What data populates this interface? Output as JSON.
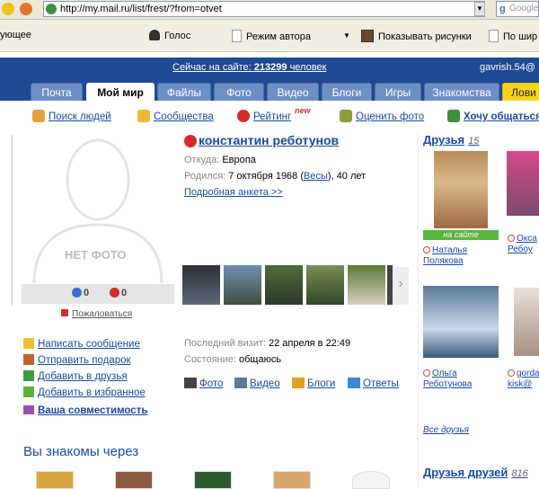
{
  "browser": {
    "url": "http://my.mail.ru/list/frest/?from=otvet",
    "search_hint": "Google",
    "toolbar": {
      "left_partial": "ующее",
      "voice": "Голос",
      "author_mode": "Режим автора",
      "show_images": "Показывать рисунки",
      "more": "По шир"
    }
  },
  "header": {
    "online_prefix": "Сейчас на сайте:",
    "online_count": "213299",
    "online_suffix": "человек",
    "user": "gavrish.54@",
    "tabs": [
      "Почта",
      "Мой мир",
      "Файлы",
      "Фото",
      "Видео",
      "Блоги",
      "Игры",
      "Знакомства",
      "Лови"
    ]
  },
  "quicklinks": {
    "people": "Поиск людей",
    "communities": "Сообщества",
    "rating": "Рейтинг",
    "rating_badge": "new",
    "rate_photo": "Оценить фото",
    "want_chat": "Хочу общаться"
  },
  "left": {
    "no_photo": "НЕТ ФОТО",
    "votes_plus": "0",
    "votes_minus": "0",
    "complain": "Пожаловаться",
    "actions": [
      "Написать сообщение",
      "Отправить подарок",
      "Добавить в друзья",
      "Добавить в избранное"
    ],
    "compat": "Ваша совместимость",
    "through_title": "Вы знакомы через"
  },
  "profile": {
    "name": "константин реботунов",
    "from_label": "Откуда:",
    "from_value": "Европа",
    "born_label": "Родился:",
    "born_date": "7 октября 1968",
    "born_sign": "Весы",
    "born_age": ", 40 лет",
    "more_link": "Подробная анкета >>",
    "last_visit_label": "Последний визит:",
    "last_visit_value": "22 апреля в 22:49",
    "status_label": "Состояние:",
    "status_value": "общаюсь",
    "services": [
      "Фото",
      "Видео",
      "Блоги",
      "Ответы"
    ]
  },
  "friends": {
    "title": "Друзья",
    "count": "15",
    "onsite_badge": "на сайте",
    "items": [
      {
        "first": "Наталья",
        "last": "Полякова"
      },
      {
        "first": "Окса",
        "last": "Ребоу"
      },
      {
        "first": "Ольга",
        "last": "Реботунова"
      },
      {
        "first": "gorda",
        "last": "kisk@"
      }
    ],
    "all_link": "Все друзья",
    "fof_title": "Друзья друзей",
    "fof_count": "816"
  },
  "colors": {
    "header_blue": "#1e4a94",
    "tab_blue": "#6d8fc6",
    "link_blue": "#1a49a6",
    "online_green": "#59b442",
    "accent_red": "#d62b2b",
    "yellow_tab": "#f7d51d"
  }
}
